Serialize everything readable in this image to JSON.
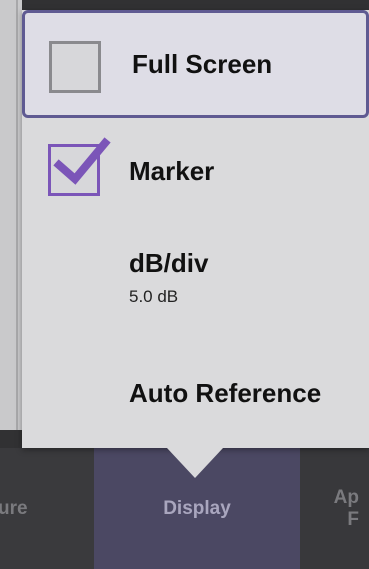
{
  "popup_menu": {
    "items": [
      {
        "label": "Full Screen",
        "checked": false,
        "highlighted": true
      },
      {
        "label": "Marker",
        "checked": true
      },
      {
        "label": "dB/div",
        "value": "5.0 dB"
      },
      {
        "label": "Auto Reference"
      }
    ]
  },
  "toolbar": {
    "tabs": [
      {
        "label": "ure"
      },
      {
        "label": "Display",
        "active": true
      },
      {
        "label_line1": "Ap",
        "label_line2": "F"
      }
    ]
  },
  "colors": {
    "accent": "#5f5a92",
    "checkbox_checked": "#7b55b8",
    "popup_bg": "#dadadc",
    "toolbar_active": "#4b4863"
  }
}
